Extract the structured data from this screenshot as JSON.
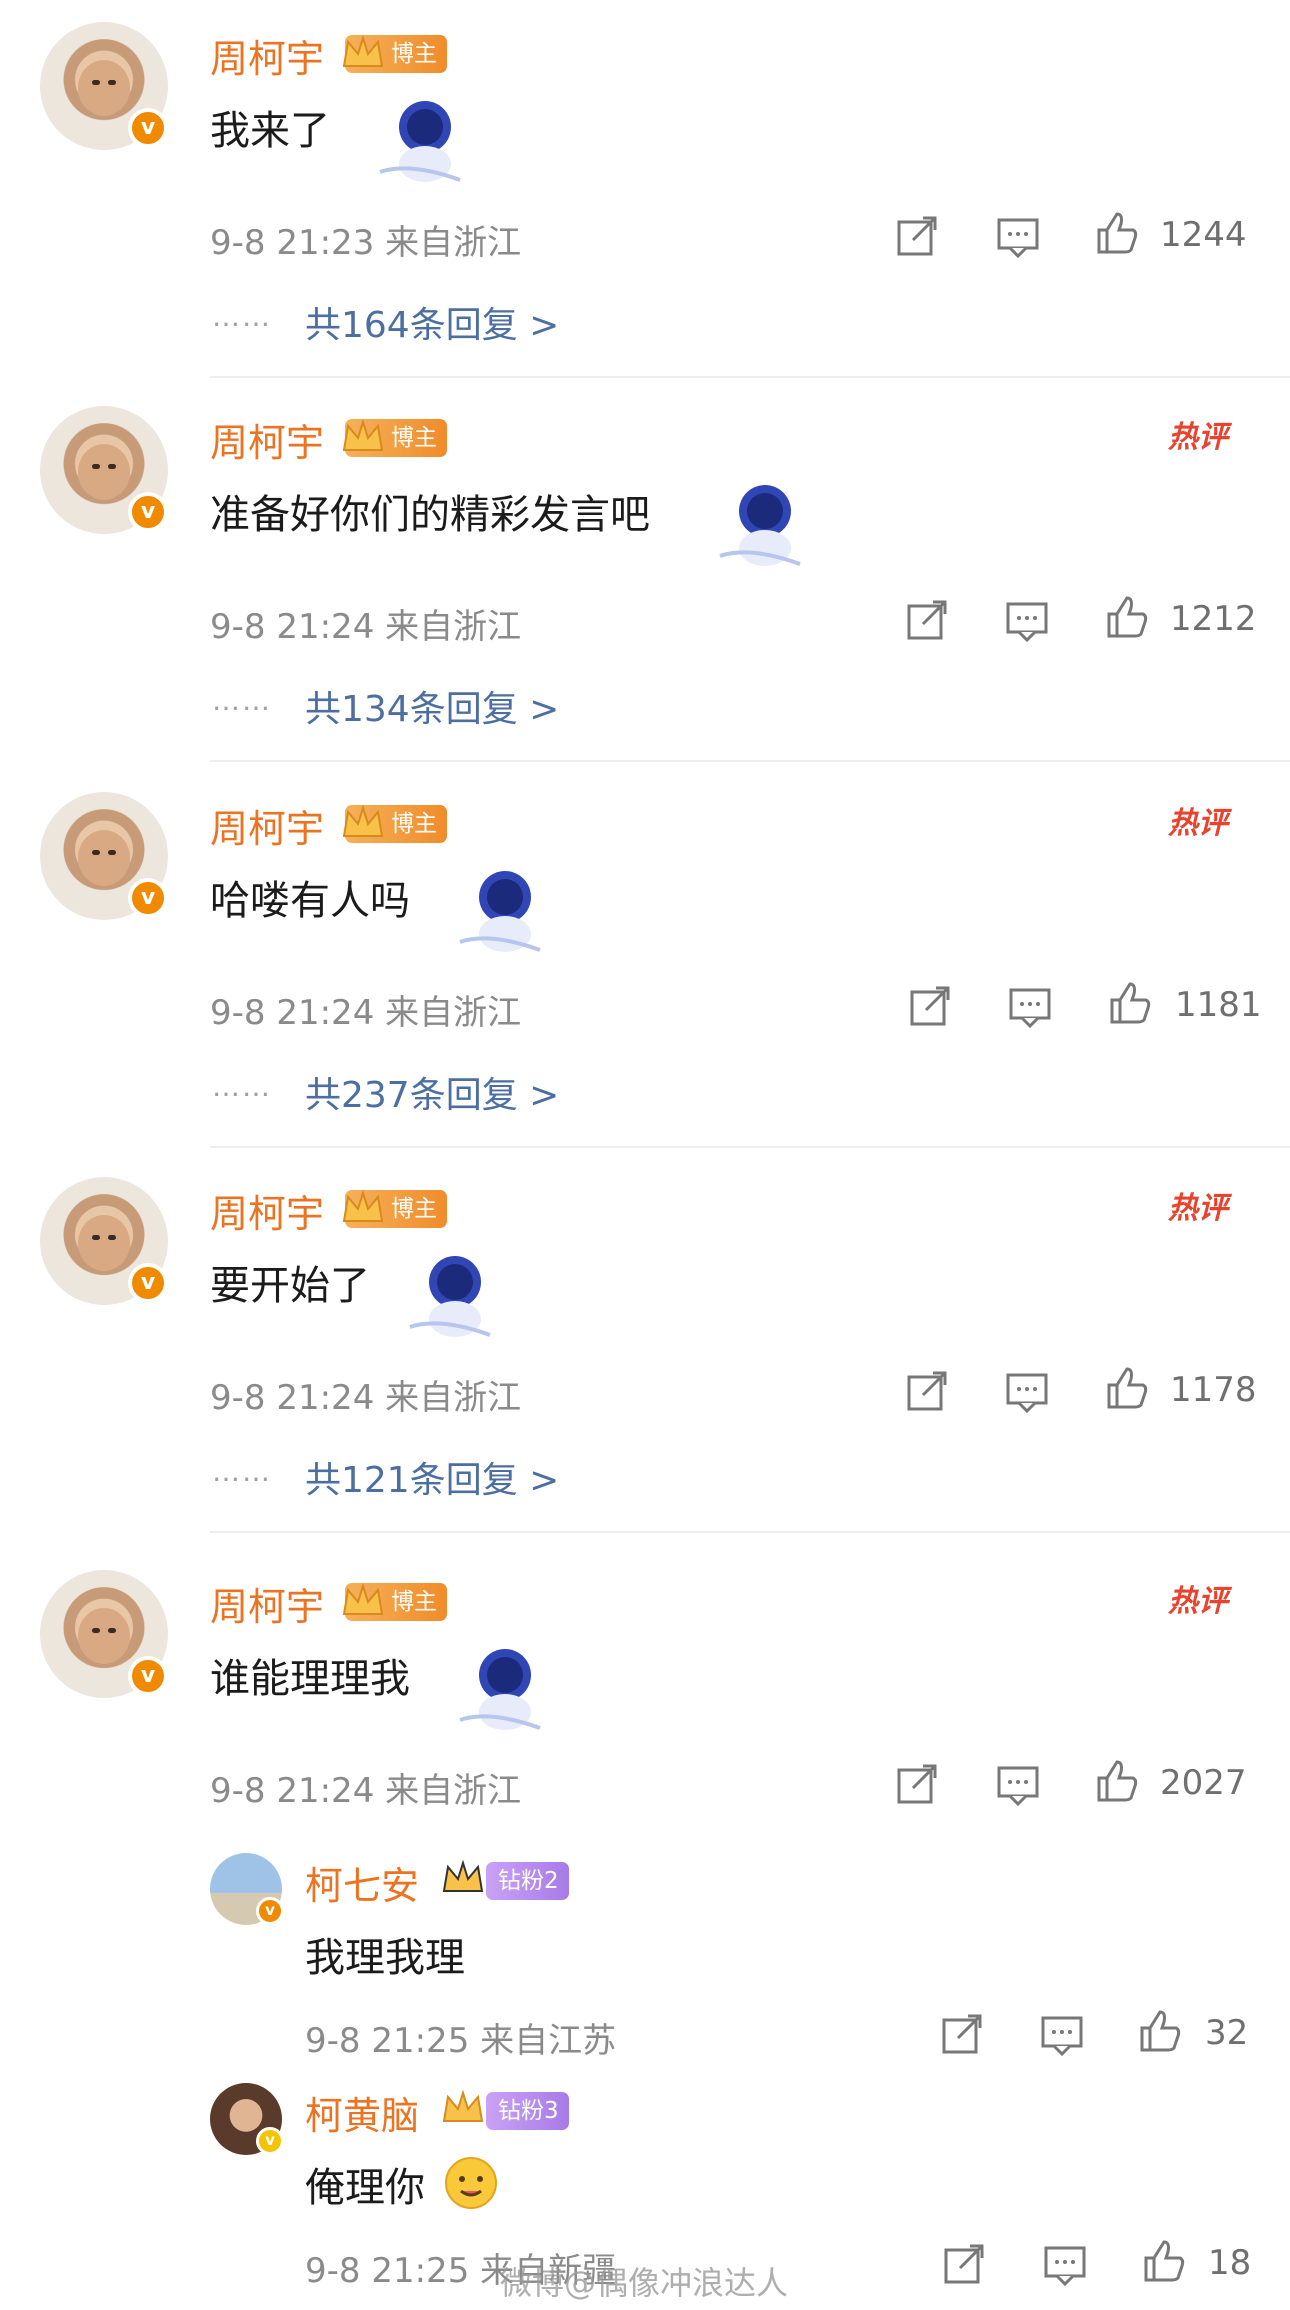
{
  "comments": [
    {
      "user": "周柯宇",
      "badge": "博主",
      "text": "我来了",
      "time": "9-8 21:23  来自浙江",
      "likes": "1244",
      "replies": "共164条回复 >",
      "hot": false
    },
    {
      "user": "周柯宇",
      "badge": "博主",
      "text": "准备好你们的精彩发言吧",
      "time": "9-8 21:24  来自浙江",
      "likes": "1212",
      "replies": "共134条回复 >",
      "hot": true
    },
    {
      "user": "周柯宇",
      "badge": "博主",
      "text": "哈喽有人吗",
      "time": "9-8 21:24  来自浙江",
      "likes": "1181",
      "replies": "共237条回复 >",
      "hot": true
    },
    {
      "user": "周柯宇",
      "badge": "博主",
      "text": "要开始了",
      "time": "9-8 21:24  来自浙江",
      "likes": "1178",
      "replies": "共121条回复 >",
      "hot": true
    },
    {
      "user": "周柯宇",
      "badge": "博主",
      "text": "谁能理理我",
      "time": "9-8 21:24  来自浙江",
      "likes": "2027",
      "replies": "",
      "hot": true
    }
  ],
  "sub_replies": [
    {
      "user": "柯七安",
      "badge": "钻粉2",
      "text": "我理我理",
      "time": "9-8 21:25  来自江苏",
      "likes": "32"
    },
    {
      "user": "柯黄脑",
      "badge": "钻粉3",
      "text": "俺理你",
      "time": "9-8 21:25  来自新疆",
      "likes": "18"
    }
  ],
  "hot_label": "热评",
  "dots": "……",
  "watermark": "微博@偶像冲浪达人",
  "colors": {
    "username": "#eb7322",
    "reply_link": "#4c6ea0",
    "hot": "#e8432f",
    "vip": "#f08a00"
  },
  "icons": {
    "share": "share-icon",
    "comment": "comment-icon",
    "like": "thumbs-up-icon",
    "sticker": "astronaut-sticker",
    "emoji": "drooling-face-emoji"
  }
}
